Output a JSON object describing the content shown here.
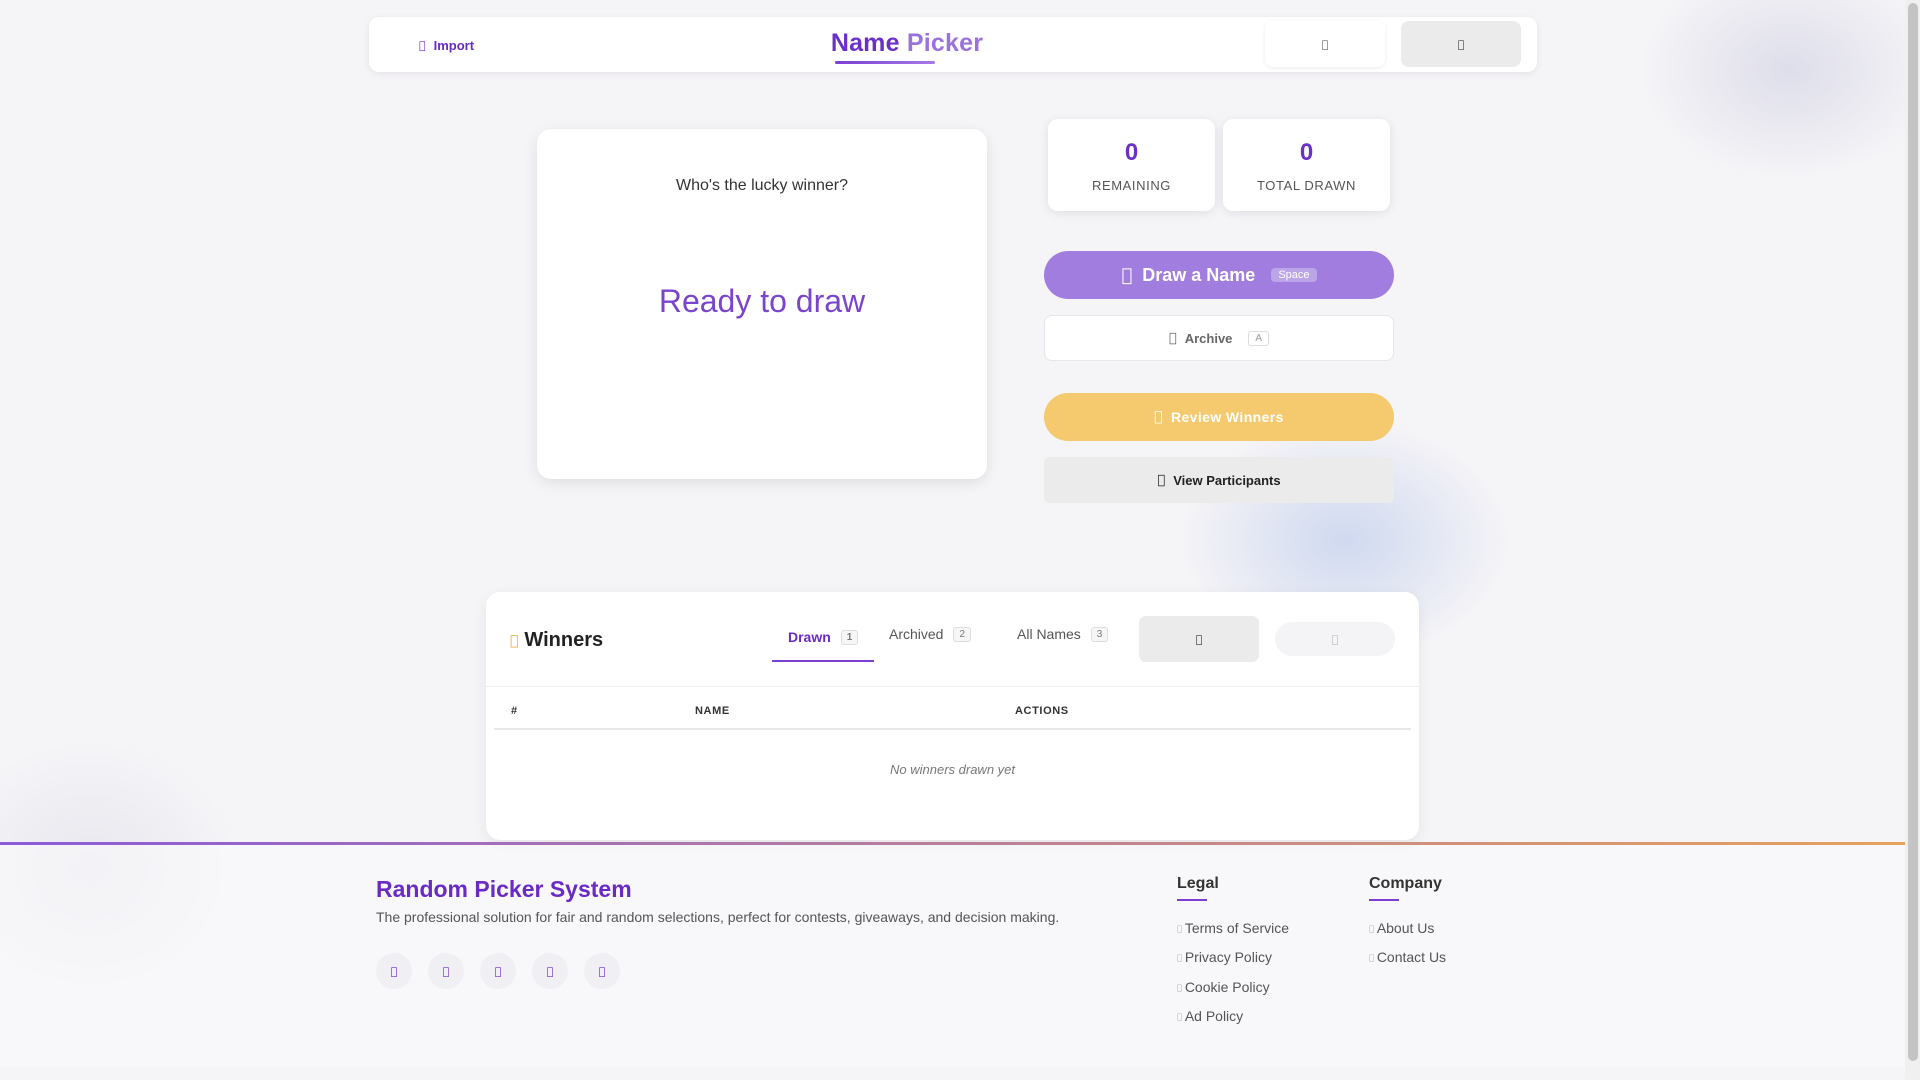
{
  "header": {
    "import_label": "Import",
    "import_icon": "",
    "brand_word1": "Name",
    "brand_word2": "Picker",
    "btn1_icon": "",
    "btn2_icon": ""
  },
  "draw_card": {
    "prompt": "Who's the lucky winner?",
    "status": "Ready to draw"
  },
  "stats": {
    "remaining_value": "0",
    "remaining_label": "REMAINING",
    "total_value": "0",
    "total_label": "TOTAL DRAWN"
  },
  "actions": {
    "draw_icon": "",
    "draw_label": "Draw a Name",
    "draw_kbd": "Space",
    "archive_icon": "",
    "archive_label": "Archive",
    "archive_kbd": "A",
    "review_icon": "",
    "review_label": "Review Winners",
    "participants_icon": "",
    "participants_label": "View Participants"
  },
  "winners": {
    "title_icon": "",
    "title": "Winners",
    "tabs": [
      {
        "label": "Drawn",
        "count": "1"
      },
      {
        "label": "Archived",
        "count": "2"
      },
      {
        "label": "All Names",
        "count": "3"
      }
    ],
    "btn1_icon": "",
    "btn2_icon": "",
    "columns": [
      "#",
      "NAME",
      "ACTIONS"
    ],
    "empty_message": "No winners drawn yet"
  },
  "footer": {
    "brand": "Random Picker System",
    "description": "The professional solution for fair and random selections, perfect for contests, giveaways, and decision making.",
    "social_icons": [
      "facebook-icon",
      "twitter-icon",
      "instagram-icon",
      "linkedin-icon",
      "youtube-icon"
    ],
    "social_glyph": "",
    "legal_title": "Legal",
    "legal_links": [
      "Terms of Service",
      "Privacy Policy",
      "Cookie Policy",
      "Ad Policy"
    ],
    "company_title": "Company",
    "company_links": [
      "About Us",
      "Contact Us"
    ],
    "link_glyph": ""
  },
  "colors": {
    "accent": "#6a2bc4",
    "draw_button": "#a07ddf",
    "review_button": "#f5c96d"
  }
}
